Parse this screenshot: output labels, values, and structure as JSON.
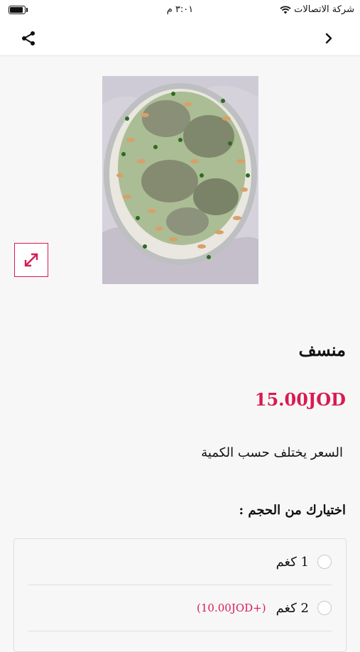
{
  "status_bar": {
    "carrier": "شركة الاتصالات",
    "time": "٣:٠١ م",
    "battery_level": 0.9
  },
  "nav": {
    "back_icon": "chevron-right-icon",
    "share_icon": "share-icon"
  },
  "product": {
    "image_icon": "food-photo",
    "expand_icon": "expand-arrows-icon",
    "name": "منسف",
    "price": "15.00JOD",
    "note": "السعر يختلف حسب الكمية"
  },
  "size_section": {
    "label": "اختيارك من الحجم :",
    "options": [
      {
        "label": "1 كغم",
        "extra": ""
      },
      {
        "label": "2 كغم",
        "extra": "(+10.00JOD)"
      }
    ]
  },
  "colors": {
    "accent": "#d81b51"
  }
}
